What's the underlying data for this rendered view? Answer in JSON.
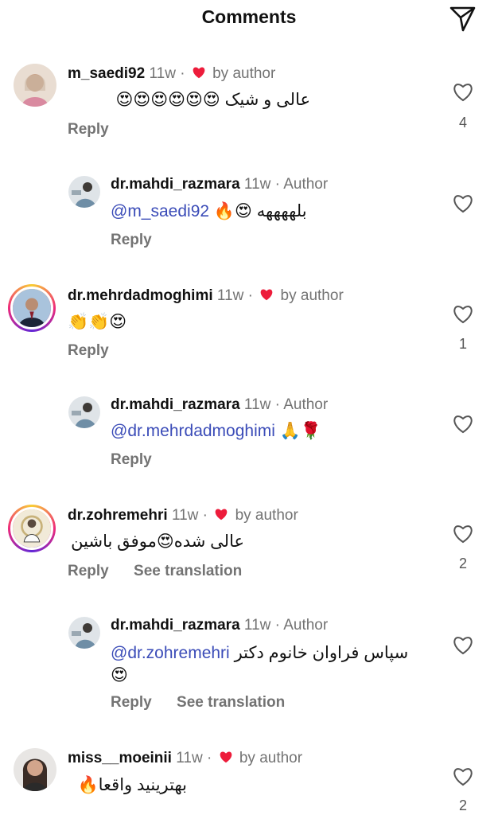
{
  "header": {
    "title": "Comments"
  },
  "comments": [
    {
      "username": "m_saedi92",
      "time": "11w",
      "sep": "·",
      "liked_by": "by author",
      "text": "عالی و شیک 😍😍😍😍😍😍",
      "reply_label": "Reply",
      "likes": "4"
    },
    {
      "username": "dr.mahdi_razmara",
      "time": "11w",
      "sep": "·",
      "author_tag": "Author",
      "mention": "@m_saedi92",
      "text": "بلههههه 😍🔥",
      "reply_label": "Reply"
    },
    {
      "username": "dr.mehrdadmoghimi",
      "time": "11w",
      "sep": "·",
      "liked_by": "by author",
      "text": "👏👏😍",
      "reply_label": "Reply",
      "likes": "1"
    },
    {
      "username": "dr.mahdi_razmara",
      "time": "11w",
      "sep": "·",
      "author_tag": "Author",
      "mention": "@dr.mehrdadmoghimi",
      "text": "🙏🌹",
      "reply_label": "Reply"
    },
    {
      "username": "dr.zohremehri",
      "time": "11w",
      "sep": "·",
      "liked_by": "by author",
      "text": "عالی شده😍موفق باشین",
      "reply_label": "Reply",
      "translate_label": "See translation",
      "likes": "2"
    },
    {
      "username": "dr.mahdi_razmara",
      "time": "11w",
      "sep": "·",
      "author_tag": "Author",
      "mention": "@dr.zohremehri",
      "text": "سپاس فراوان خانوم دکتر",
      "text_line2": "😍",
      "reply_label": "Reply",
      "translate_label": "See translation"
    },
    {
      "username": "miss__moeinii",
      "time": "11w",
      "sep": "·",
      "liked_by": "by author",
      "text": "بهترینید واقعا🔥",
      "likes": "2"
    }
  ],
  "colors": {
    "heart_red": "#ed1c3b",
    "mention_blue": "#3b4cb8",
    "meta_gray": "#737373"
  }
}
